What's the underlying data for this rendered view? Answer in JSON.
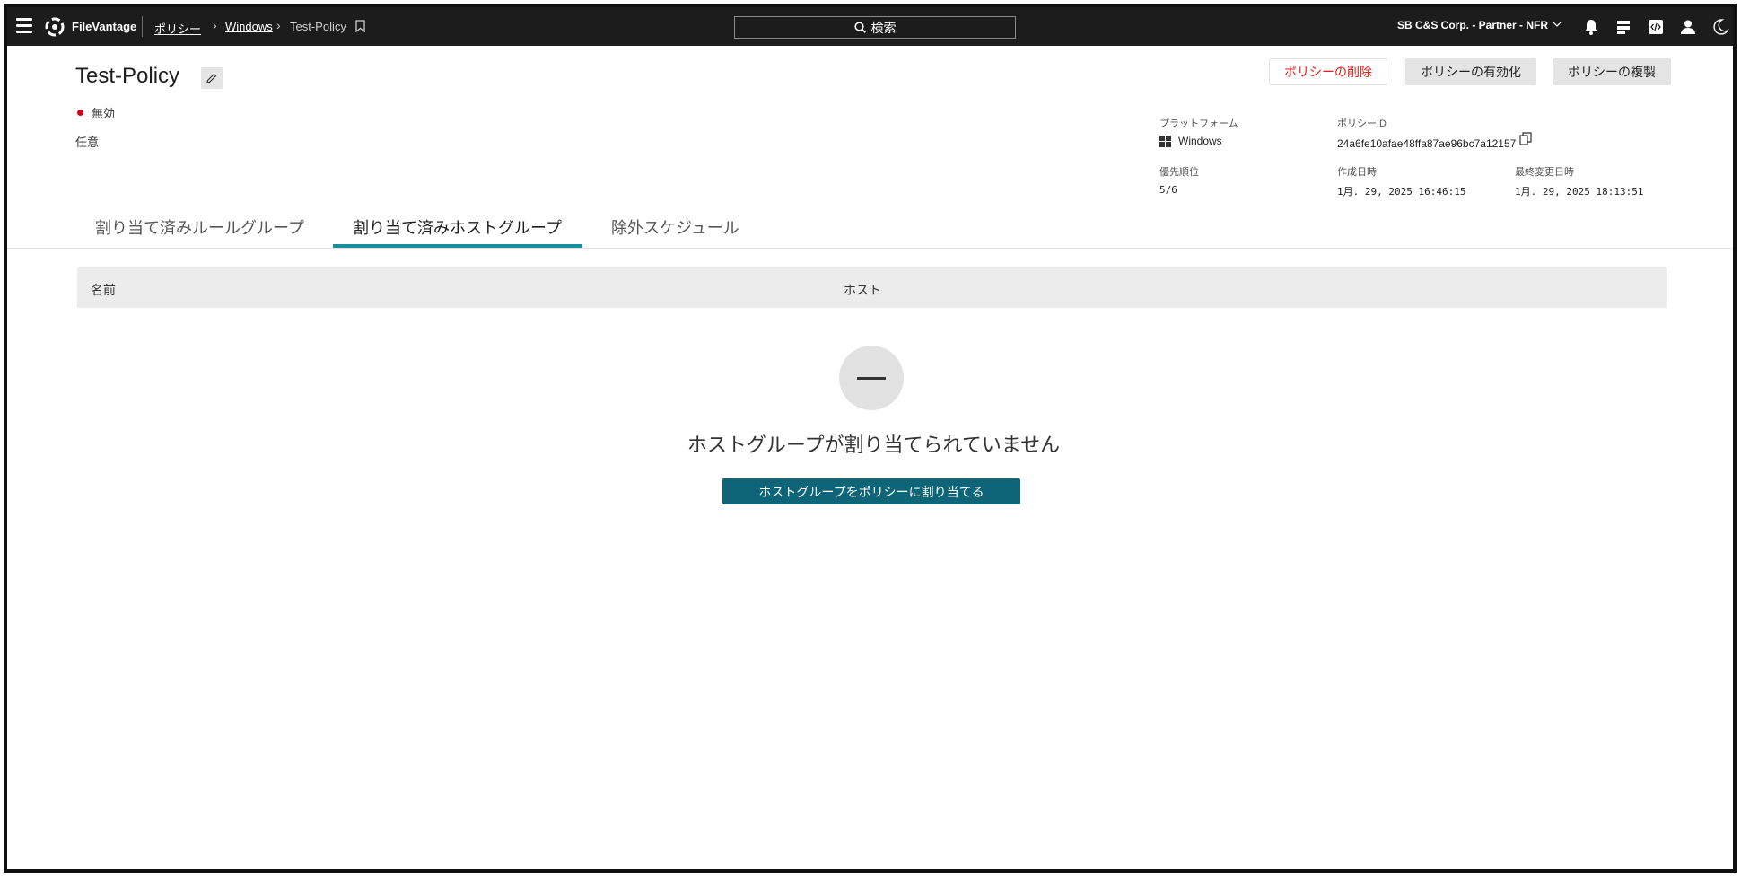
{
  "app": {
    "name": "FileVantage"
  },
  "breadcrumb": {
    "items": [
      "ポリシー",
      "Windows",
      "Test-Policy"
    ]
  },
  "search": {
    "label": "検索"
  },
  "tenant": {
    "name": "SB C&S Corp. - Partner - NFR"
  },
  "topbar_icons": [
    "bell-icon",
    "cloud-stack-icon",
    "code-icon",
    "user-icon",
    "moon-icon"
  ],
  "policy": {
    "title": "Test-Policy",
    "status": "無効",
    "status_color": "#d0021b",
    "description": "任意"
  },
  "actions": {
    "delete": "ポリシーの削除",
    "enable": "ポリシーの有効化",
    "duplicate": "ポリシーの複製"
  },
  "meta": {
    "platform_label": "プラットフォーム",
    "platform_value": "Windows",
    "policy_id_label": "ポリシーID",
    "policy_id_value": "24a6fe10afae48ffa87ae96bc7a12157",
    "priority_label": "優先順位",
    "priority_value": "5/6",
    "created_label": "作成日時",
    "created_value": "1月. 29, 2025 16:46:15",
    "modified_label": "最終変更日時",
    "modified_value": "1月. 29, 2025 18:13:51"
  },
  "tabs": [
    {
      "label": "割り当て済みルールグループ",
      "active": false
    },
    {
      "label": "割り当て済みホストグループ",
      "active": true
    },
    {
      "label": "除外スケジュール",
      "active": false
    }
  ],
  "table": {
    "columns": [
      "名前",
      "ホスト"
    ],
    "rows": []
  },
  "empty_state": {
    "title": "ホストグループが割り当てられていません",
    "button": "ホストグループをポリシーに割り当てる"
  },
  "colors": {
    "topbar": "#1c1c1c",
    "accent": "#1a8fa0",
    "primary_button": "#0d6577",
    "danger": "#e0201a"
  }
}
